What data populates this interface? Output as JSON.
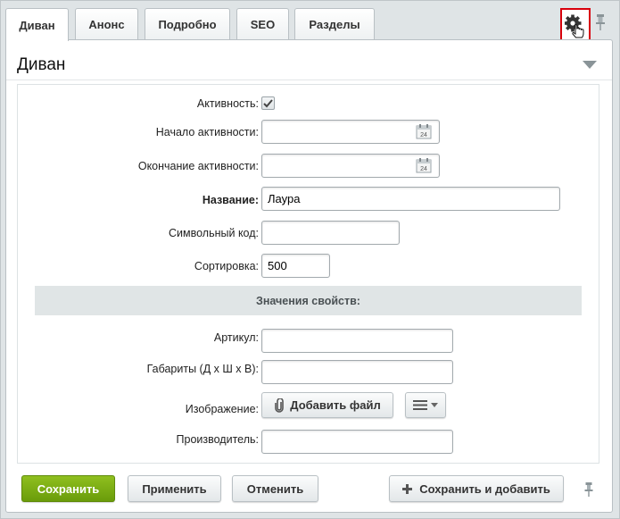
{
  "tabs": [
    {
      "label": "Диван",
      "active": true
    },
    {
      "label": "Анонс",
      "active": false
    },
    {
      "label": "Подробно",
      "active": false
    },
    {
      "label": "SEO",
      "active": false
    },
    {
      "label": "Разделы",
      "active": false
    }
  ],
  "header": {
    "title": "Диван",
    "settings_icon": "gear-icon",
    "pin_icon": "pin-icon",
    "collapse_icon": "triangle-down-icon"
  },
  "form": {
    "active": {
      "label": "Активность:",
      "checked": true
    },
    "start": {
      "label": "Начало активности:",
      "value": ""
    },
    "end": {
      "label": "Окончание активности:",
      "value": ""
    },
    "name": {
      "label": "Название:",
      "value": "Лаура"
    },
    "code": {
      "label": "Символьный код:",
      "value": ""
    },
    "sort": {
      "label": "Сортировка:",
      "value": "500"
    },
    "section_title": "Значения свойств:",
    "article": {
      "label": "Артикул:",
      "value": ""
    },
    "dimensions": {
      "label": "Габариты (Д х Ш х В):",
      "value": ""
    },
    "image": {
      "label": "Изображение:",
      "add_button": "Добавить файл"
    },
    "manufacturer": {
      "label": "Производитель:",
      "value": ""
    }
  },
  "footer": {
    "save": "Сохранить",
    "apply": "Применить",
    "cancel": "Отменить",
    "save_add": "Сохранить и добавить"
  },
  "colors": {
    "accent_green": "#7aad14",
    "highlight_red": "#d8000c"
  }
}
